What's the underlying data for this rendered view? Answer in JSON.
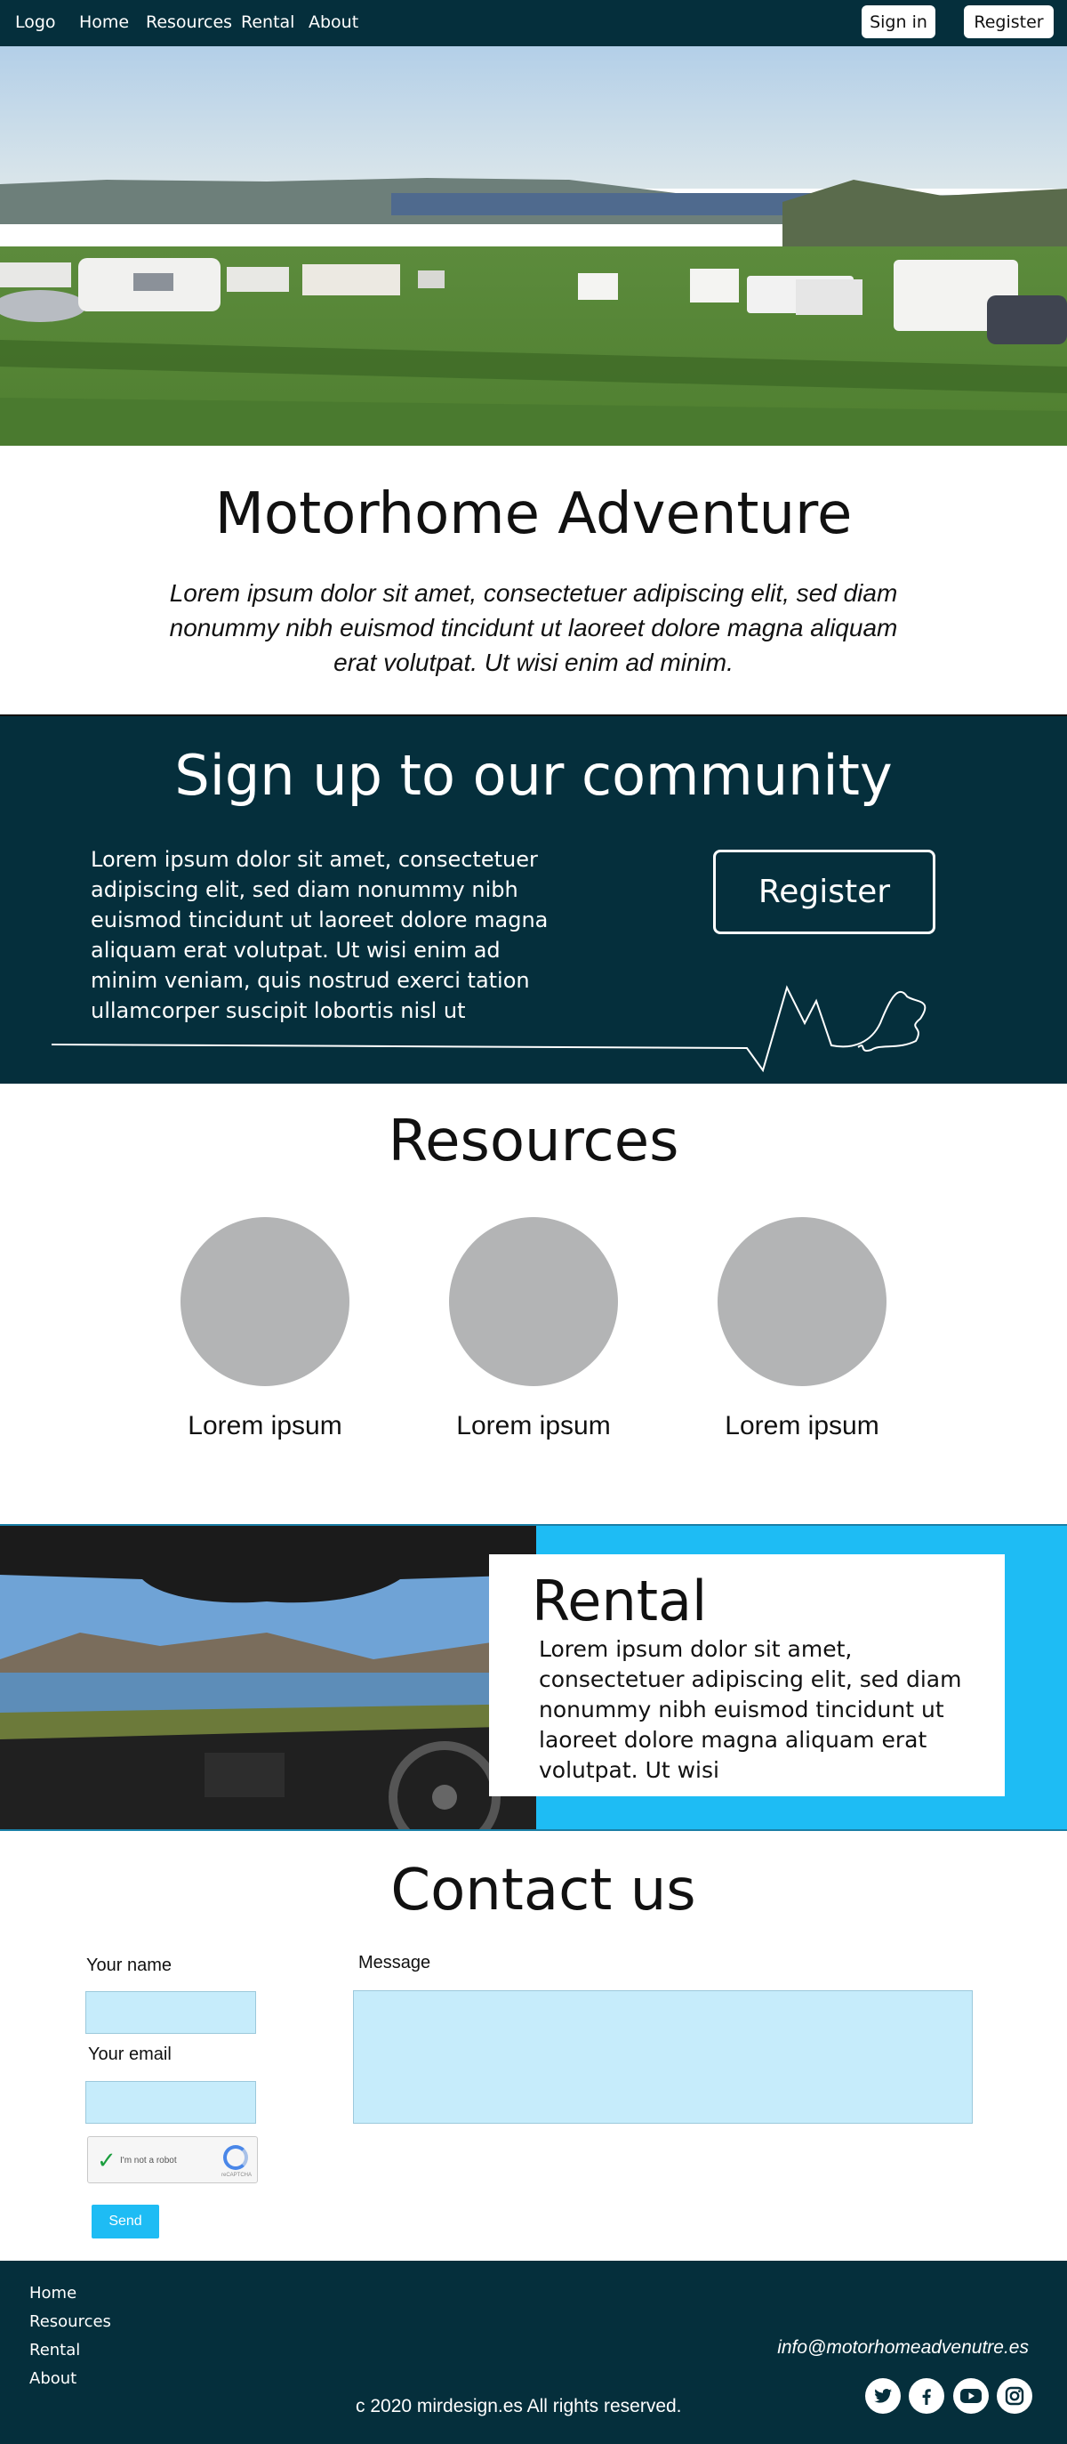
{
  "nav": {
    "logo": "Logo",
    "links": [
      "Home",
      "Resources",
      "Rental",
      "About"
    ],
    "signin": "Sign in",
    "register": "Register"
  },
  "hero": {
    "image": "campsite with motorhomes"
  },
  "intro": {
    "title": "Motorhome Adventure",
    "text": "Lorem ipsum dolor sit amet, consectetuer adipiscing elit, sed diam nonummy nibh euismod tincidunt ut laoreet dolore magna aliquam erat volutpat. Ut wisi enim ad minim."
  },
  "community": {
    "title": "Sign up to our community",
    "text": "Lorem ipsum dolor sit amet, consectetuer adipiscing elit, sed diam nonummy nibh euismod tincidunt ut laoreet dolore magna aliquam erat volutpat. Ut wisi enim ad minim veniam, quis nostrud exerci tation ullamcorper suscipit lobortis nisl ut",
    "button": "Register"
  },
  "resources": {
    "title": "Resources",
    "items": [
      "Lorem ipsum",
      "Lorem ipsum",
      "Lorem ipsum"
    ]
  },
  "rental": {
    "title": "Rental",
    "text": "Lorem ipsum dolor sit amet, consectetuer adipiscing elit, sed diam nonummy nibh euismod tincidunt ut laoreet dolore magna aliquam erat volutpat. Ut wisi"
  },
  "contact": {
    "title": "Contact us",
    "name_label": "Your name",
    "email_label": "Your email",
    "message_label": "Message",
    "captcha_label": "I'm not a robot",
    "captcha_sub": "reCAPTCHA",
    "send": "Send"
  },
  "footer": {
    "links": [
      "Home",
      "Resources",
      "Rental",
      "About"
    ],
    "email": "info@motorhomeadvenutre.es",
    "copyright": "c 2020 mirdesign.es All rights reserved.",
    "social": [
      "twitter-icon",
      "facebook-icon",
      "youtube-icon",
      "instagram-icon"
    ]
  },
  "colors": {
    "dark": "#052f3c",
    "accent": "#1ebcf4",
    "field": "#c6ecfb",
    "placeholder": "#b3b4b5"
  }
}
